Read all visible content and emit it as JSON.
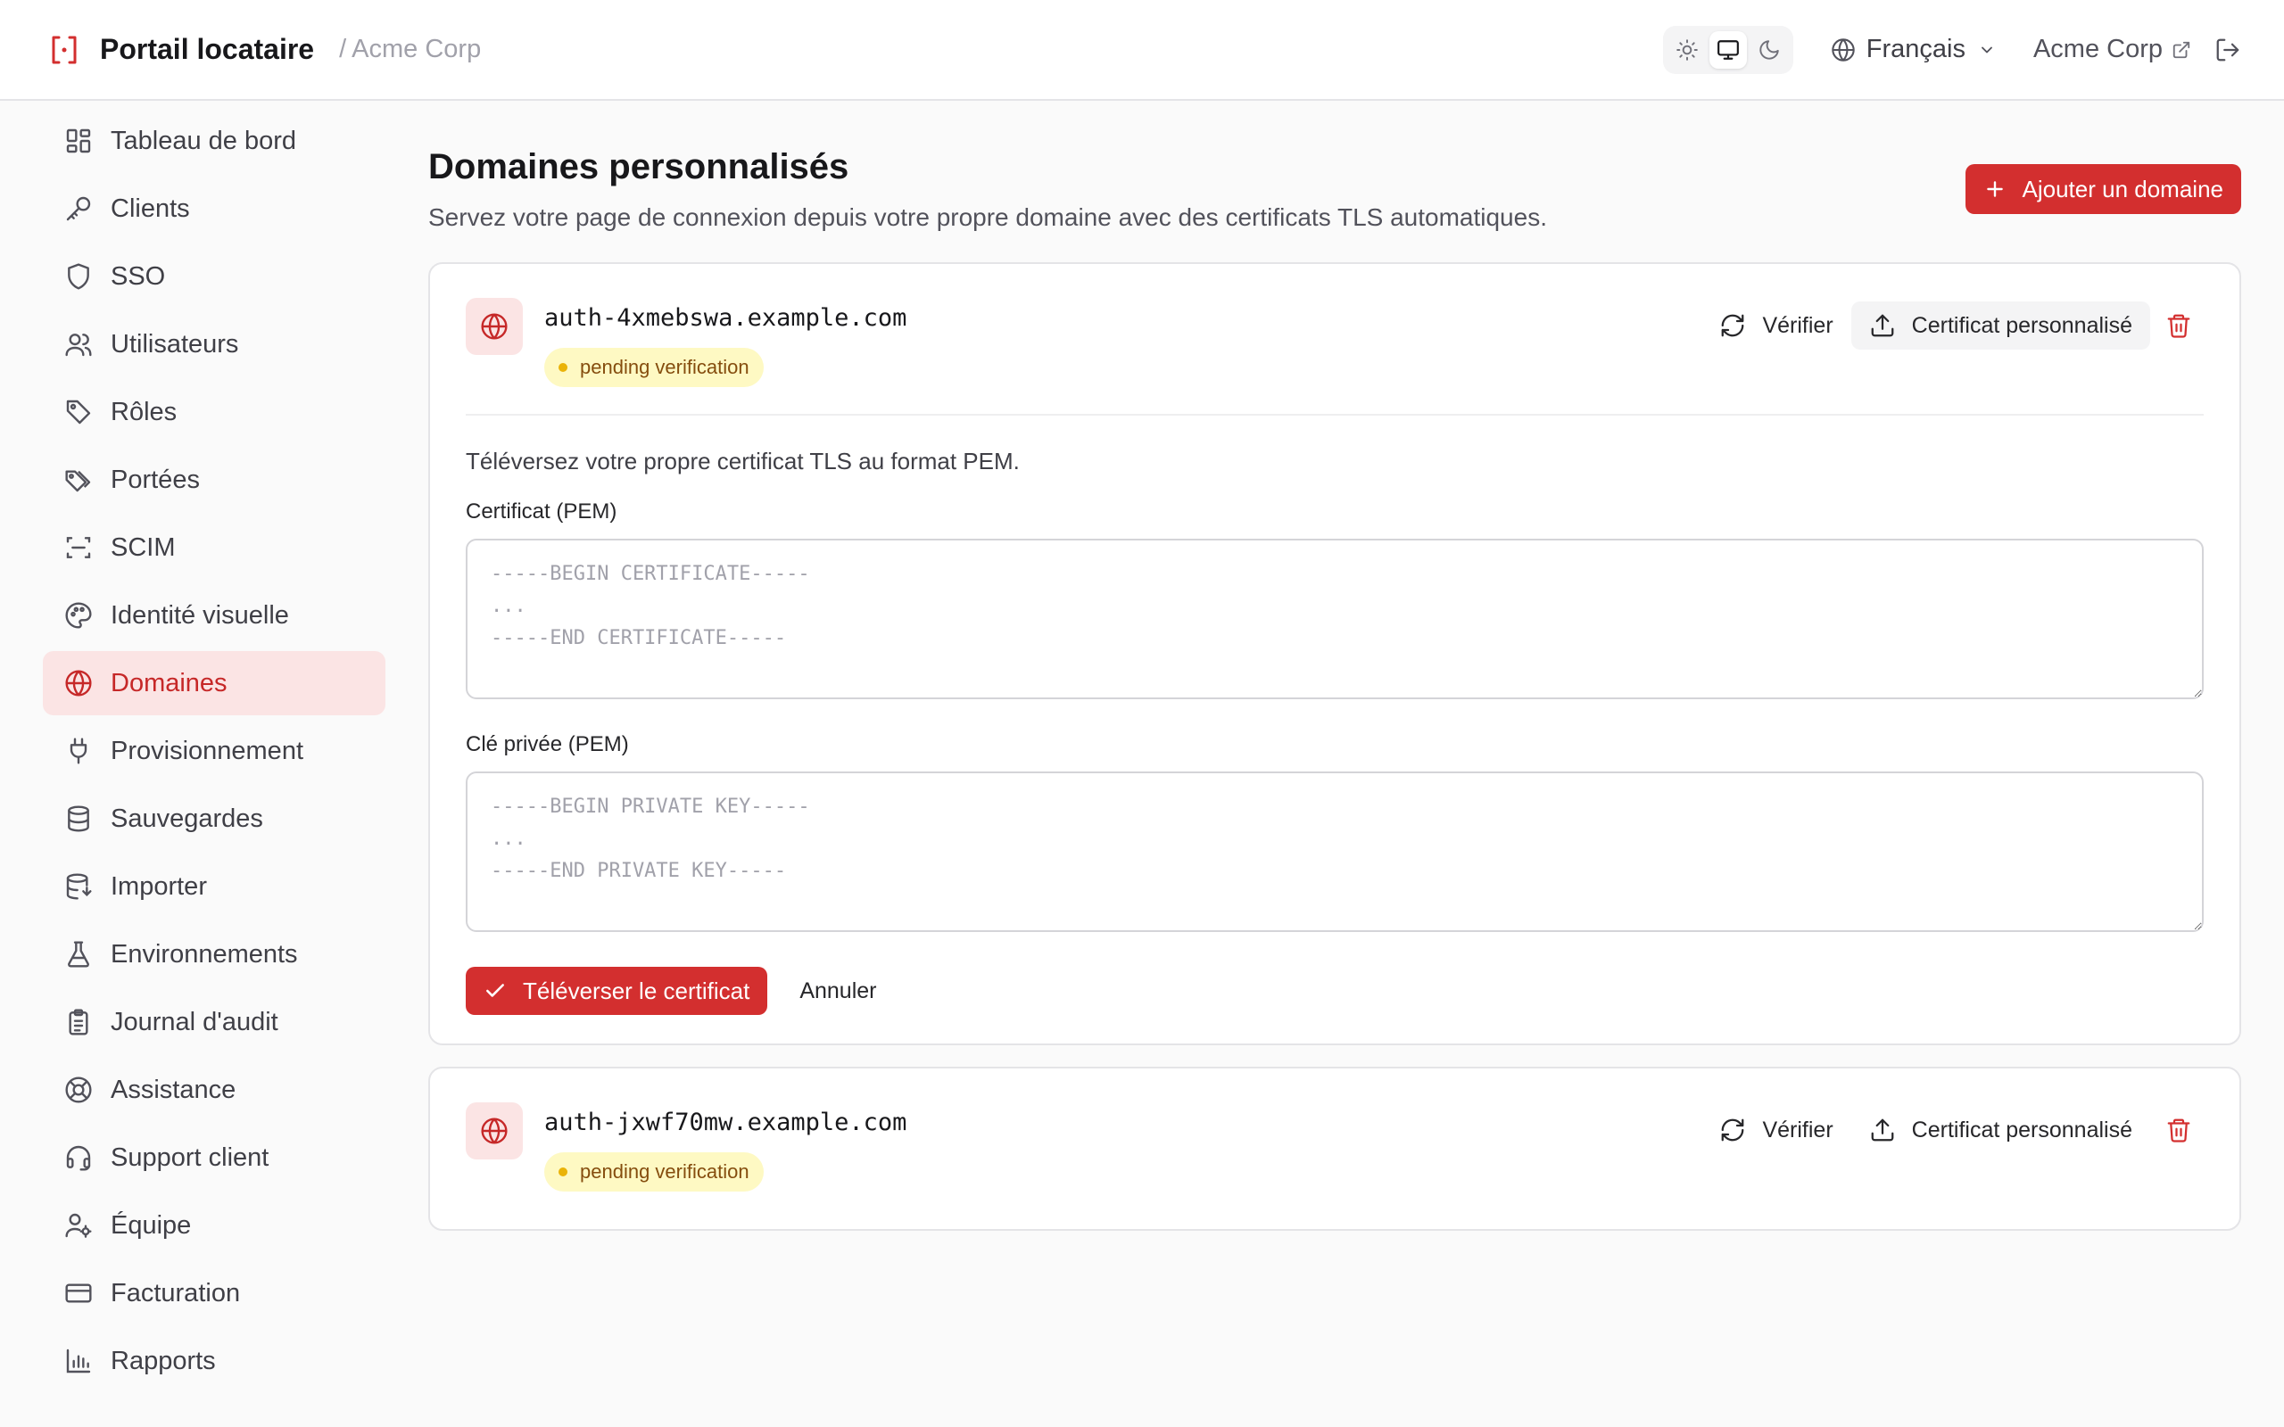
{
  "header": {
    "title": "Portail locataire",
    "breadcrumb_sep": "/",
    "breadcrumb_tenant": "Acme Corp",
    "theme_options": [
      "light",
      "system",
      "dark"
    ],
    "theme_active": "system",
    "language": "Français",
    "tenant_link": "Acme Corp",
    "accent": "#d32f2f"
  },
  "sidebar": {
    "items": [
      {
        "label": "Tableau de bord",
        "icon": "dashboard-icon"
      },
      {
        "label": "Clients",
        "icon": "key-icon"
      },
      {
        "label": "SSO",
        "icon": "shield-icon"
      },
      {
        "label": "Utilisateurs",
        "icon": "users-icon"
      },
      {
        "label": "Rôles",
        "icon": "tag-icon"
      },
      {
        "label": "Portées",
        "icon": "tags-icon"
      },
      {
        "label": "SCIM",
        "icon": "scan-icon"
      },
      {
        "label": "Identité visuelle",
        "icon": "palette-icon"
      },
      {
        "label": "Domaines",
        "icon": "globe-icon",
        "active": true
      },
      {
        "label": "Provisionnement",
        "icon": "plug-icon"
      },
      {
        "label": "Sauvegardes",
        "icon": "database-icon"
      },
      {
        "label": "Importer",
        "icon": "database-import-icon"
      },
      {
        "label": "Environnements",
        "icon": "flask-icon"
      },
      {
        "label": "Journal d'audit",
        "icon": "clipboard-icon"
      },
      {
        "label": "Assistance",
        "icon": "life-buoy-icon"
      },
      {
        "label": "Support client",
        "icon": "headset-icon"
      },
      {
        "label": "Équipe",
        "icon": "user-cog-icon"
      },
      {
        "label": "Facturation",
        "icon": "credit-card-icon"
      },
      {
        "label": "Rapports",
        "icon": "bar-chart-icon"
      }
    ]
  },
  "main": {
    "title": "Domaines personnalisés",
    "subtitle": "Servez votre page de connexion depuis votre propre domaine avec des certificats TLS automatiques.",
    "add_button": "Ajouter un domaine",
    "domains": [
      {
        "name": "auth-4xmebswa.example.com",
        "status": "pending verification",
        "verify_label": "Vérifier",
        "cert_label": "Certificat personnalisé"
      },
      {
        "name": "auth-jxwf70mw.example.com",
        "status": "pending verification",
        "verify_label": "Vérifier",
        "cert_label": "Certificat personnalisé"
      }
    ],
    "upload": {
      "description": "Téléversez votre propre certificat TLS au format PEM.",
      "cert_label": "Certificat (PEM)",
      "cert_placeholder": "-----BEGIN CERTIFICATE-----\n...\n-----END CERTIFICATE-----",
      "cert_value": "",
      "key_label": "Clé privée (PEM)",
      "key_placeholder": "-----BEGIN PRIVATE KEY-----\n...\n-----END PRIVATE KEY-----",
      "key_value": "",
      "submit_label": "Téléverser le certificat",
      "cancel_label": "Annuler"
    }
  }
}
